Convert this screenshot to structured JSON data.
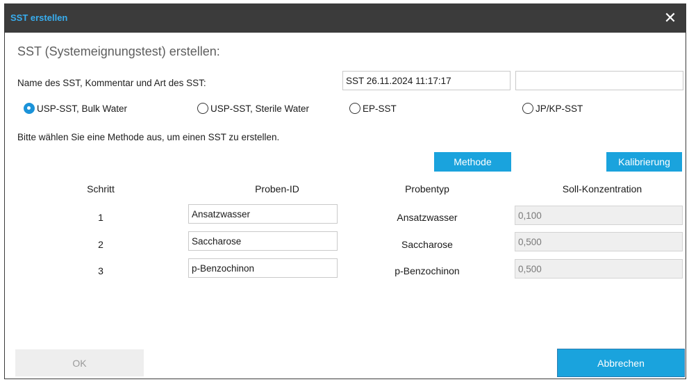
{
  "window": {
    "title": "SST erstellen",
    "close_icon": "close-icon"
  },
  "heading": "SST (Systemeignungstest) erstellen:",
  "name_section": {
    "label": "Name des SST, Kommentar und Art des SST:",
    "name_value": "SST 26.11.2024 11:17:17",
    "comment_value": ""
  },
  "sst_types": {
    "options": [
      "USP-SST, Bulk Water",
      "USP-SST, Sterile Water",
      "EP-SST",
      "JP/KP-SST"
    ],
    "selected": "USP-SST, Bulk Water"
  },
  "instruction": "Bitte wählen Sie eine Methode aus, um einen SST zu erstellen.",
  "buttons": {
    "methode": "Methode",
    "kalibrierung": "Kalibrierung",
    "ok": "OK",
    "abbrechen": "Abbrechen"
  },
  "table": {
    "headers": [
      "Schritt",
      "Proben-ID",
      "Probentyp",
      "Soll-Konzentration"
    ],
    "rows": [
      {
        "step": "1",
        "sample_id": "Ansatzwasser",
        "sample_type": "Ansatzwasser",
        "concentration": "0,100"
      },
      {
        "step": "2",
        "sample_id": "Saccharose",
        "sample_type": "Saccharose",
        "concentration": "0,500"
      },
      {
        "step": "3",
        "sample_id": "p-Benzochinon",
        "sample_type": "p-Benzochinon",
        "concentration": "0,500"
      }
    ]
  },
  "colors": {
    "accent": "#1aa3dd",
    "titlebar": "#3b3b3b",
    "title_text": "#38aef0"
  }
}
